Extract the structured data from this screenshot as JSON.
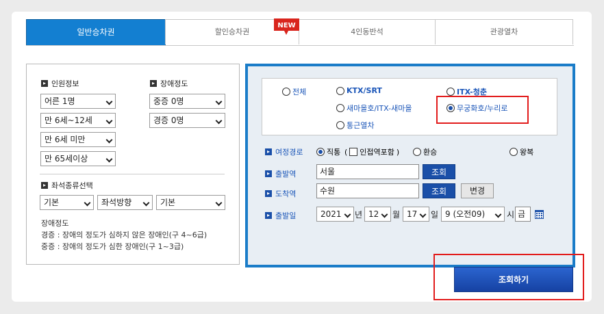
{
  "tabs": [
    {
      "label": "일반승차권",
      "active": true
    },
    {
      "label": "할인승차권",
      "badge": "NEW"
    },
    {
      "label": "4인동반석"
    },
    {
      "label": "관광열차"
    }
  ],
  "left": {
    "person_title": "인원정보",
    "disability_title": "장애정도",
    "person_selects": [
      "어른 1명",
      "만 6세~12세",
      "만 6세 미만",
      "만 65세이상"
    ],
    "disability_selects": [
      "중증 0명",
      "경증 0명"
    ],
    "seat_title": "좌석종류선택",
    "seat_selects": [
      "기본",
      "좌석방향",
      "기본"
    ],
    "note_title": "장애정도",
    "note_line1": "경증 : 장애의 정도가 심하지 않은 장애인(구 4~6급)",
    "note_line2": "중증 : 장애의 정도가 심한 장애인(구 1~3급)"
  },
  "train_types": {
    "all": "전체",
    "ktx": "KTX/SRT",
    "itx_youth": "ITX-청춘",
    "saemaeul": "새마을호/ITX-새마을",
    "mugunghwa": "무궁화호/누리로",
    "commuter": "통근열차",
    "selected": "무궁화호/누리로"
  },
  "route": {
    "label": "여정경로",
    "direct": "직통",
    "nearby": "인접역포함",
    "transfer": "환승",
    "roundtrip": "왕복"
  },
  "departure": {
    "label": "출발역",
    "value": "서울",
    "button": "조회"
  },
  "arrival": {
    "label": "도착역",
    "value": "수원",
    "button": "조회",
    "swap": "변경"
  },
  "date": {
    "label": "출발일",
    "year": "2021",
    "year_unit": "년",
    "month": "12",
    "month_unit": "월",
    "day": "17",
    "day_unit": "일",
    "hour": "9 (오전09)",
    "hour_unit": "시",
    "weekday": "금"
  },
  "search_button": "조회하기",
  "colors": {
    "accent": "#137fd1",
    "button": "#1a4fa8",
    "highlight": "#e21b1b"
  }
}
